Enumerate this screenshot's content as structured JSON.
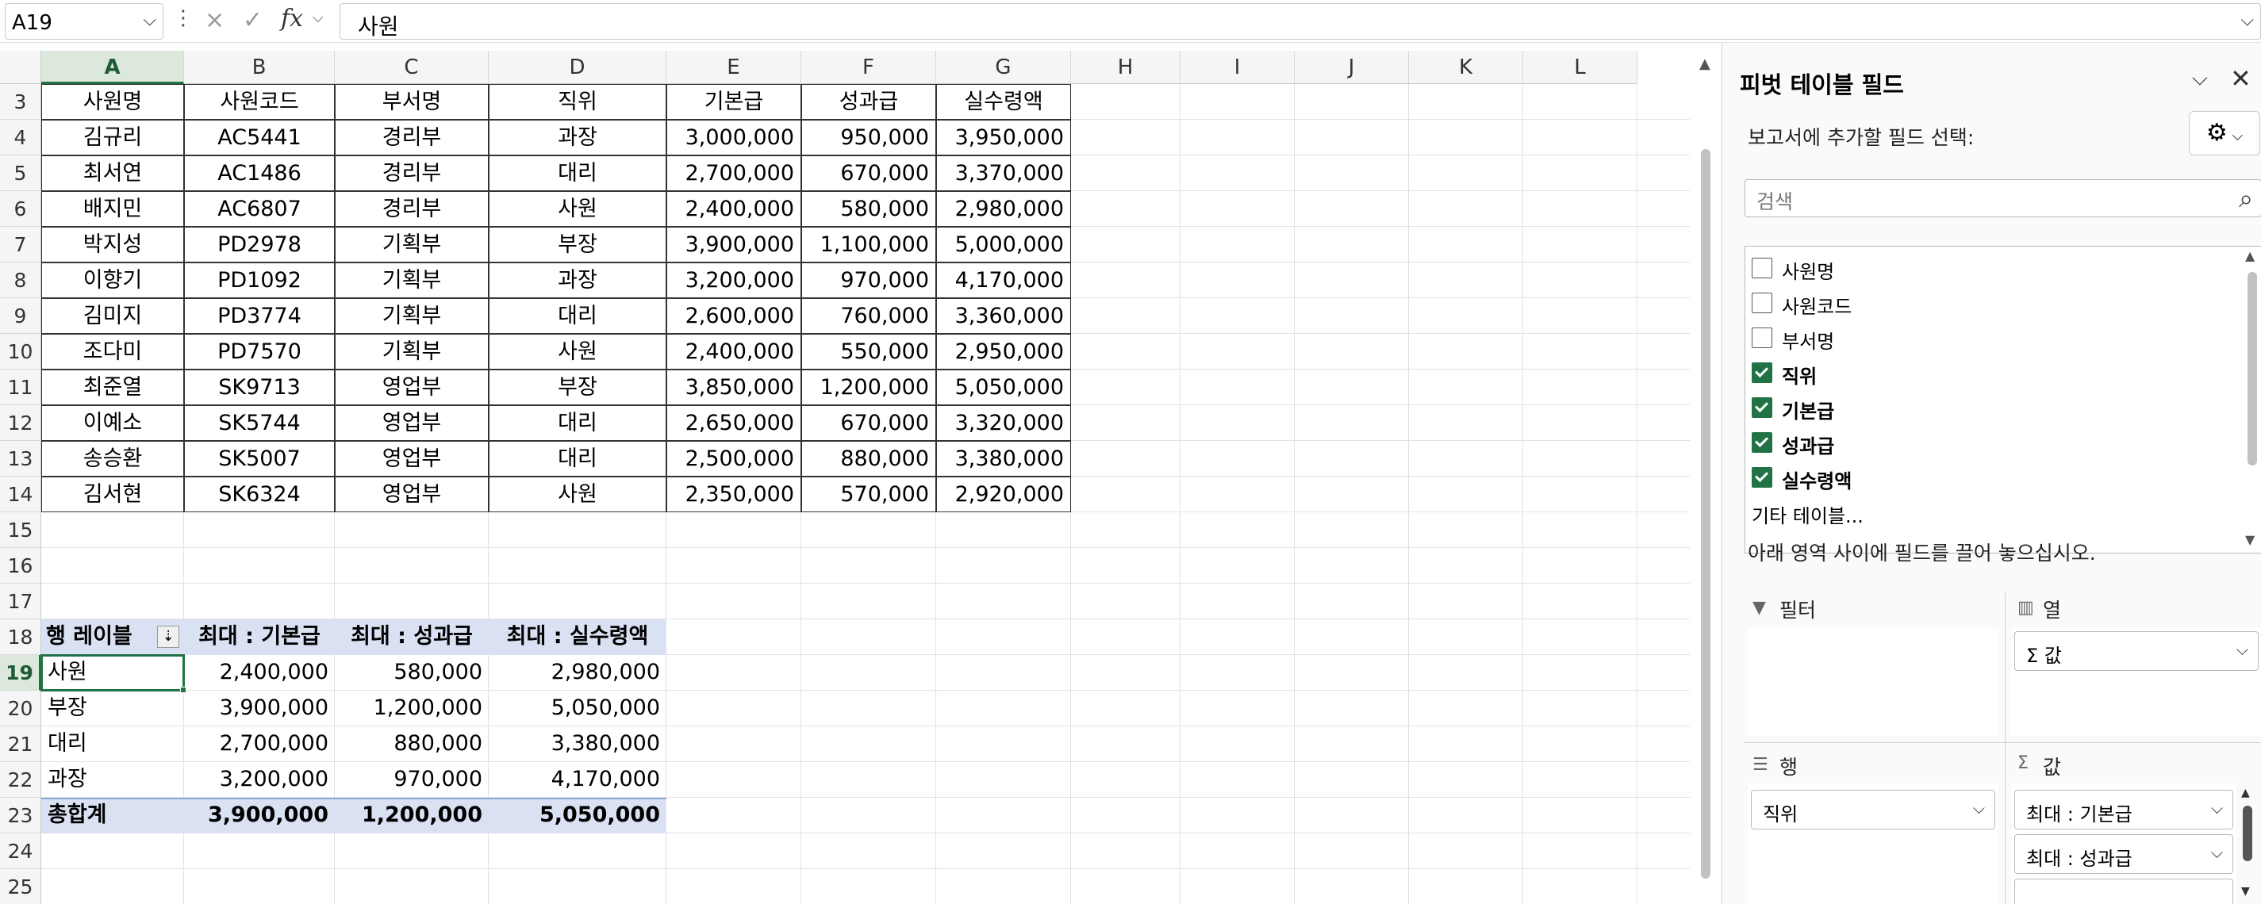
{
  "formula_bar": {
    "name_box": "A19",
    "cancel_icon": "×",
    "enter_icon": "✓",
    "fx_label": "fx",
    "formula": "사원"
  },
  "columns": [
    "A",
    "B",
    "C",
    "D",
    "E",
    "F",
    "G",
    "H",
    "I",
    "J",
    "K",
    "L"
  ],
  "rows": [
    "3",
    "4",
    "5",
    "6",
    "7",
    "8",
    "9",
    "10",
    "11",
    "12",
    "13",
    "14",
    "15",
    "16",
    "17",
    "18",
    "19",
    "20",
    "21",
    "22",
    "23",
    "24",
    "25"
  ],
  "data_table": {
    "headers": [
      "사원명",
      "사원코드",
      "부서명",
      "직위",
      "기본급",
      "성과급",
      "실수령액"
    ],
    "rows": [
      [
        "김규리",
        "AC5441",
        "경리부",
        "과장",
        "3,000,000",
        "950,000",
        "3,950,000"
      ],
      [
        "최서연",
        "AC1486",
        "경리부",
        "대리",
        "2,700,000",
        "670,000",
        "3,370,000"
      ],
      [
        "배지민",
        "AC6807",
        "경리부",
        "사원",
        "2,400,000",
        "580,000",
        "2,980,000"
      ],
      [
        "박지성",
        "PD2978",
        "기획부",
        "부장",
        "3,900,000",
        "1,100,000",
        "5,000,000"
      ],
      [
        "이향기",
        "PD1092",
        "기획부",
        "과장",
        "3,200,000",
        "970,000",
        "4,170,000"
      ],
      [
        "김미지",
        "PD3774",
        "기획부",
        "대리",
        "2,600,000",
        "760,000",
        "3,360,000"
      ],
      [
        "조다미",
        "PD7570",
        "기획부",
        "사원",
        "2,400,000",
        "550,000",
        "2,950,000"
      ],
      [
        "최준열",
        "SK9713",
        "영업부",
        "부장",
        "3,850,000",
        "1,200,000",
        "5,050,000"
      ],
      [
        "이예소",
        "SK5744",
        "영업부",
        "대리",
        "2,650,000",
        "670,000",
        "3,320,000"
      ],
      [
        "송승환",
        "SK5007",
        "영업부",
        "대리",
        "2,500,000",
        "880,000",
        "3,380,000"
      ],
      [
        "김서현",
        "SK6324",
        "영업부",
        "사원",
        "2,350,000",
        "570,000",
        "2,920,000"
      ]
    ]
  },
  "pivot": {
    "headers": [
      "행 레이블",
      "최대 : 기본급",
      "최대 : 성과급",
      "최대 : 실수령액"
    ],
    "rows": [
      [
        "사원",
        "2,400,000",
        "580,000",
        "2,980,000"
      ],
      [
        "부장",
        "3,900,000",
        "1,200,000",
        "5,050,000"
      ],
      [
        "대리",
        "2,700,000",
        "880,000",
        "3,380,000"
      ],
      [
        "과장",
        "3,200,000",
        "970,000",
        "4,170,000"
      ]
    ],
    "total": [
      "총합계",
      "3,900,000",
      "1,200,000",
      "5,050,000"
    ]
  },
  "pane": {
    "title": "피벗 테이블 필드",
    "choose_label": "보고서에 추가할 필드 선택:",
    "search_placeholder": "검색",
    "fields": [
      {
        "label": "사원명",
        "checked": false
      },
      {
        "label": "사원코드",
        "checked": false
      },
      {
        "label": "부서명",
        "checked": false
      },
      {
        "label": "직위",
        "checked": true
      },
      {
        "label": "기본급",
        "checked": true
      },
      {
        "label": "성과급",
        "checked": true
      },
      {
        "label": "실수령액",
        "checked": true
      },
      {
        "label": "기타 테이블...",
        "checked": false
      }
    ],
    "drag_hint": "아래 영역 사이에 필드를 끌어 놓으십시오.",
    "areas": {
      "filter": "필터",
      "columns": "열",
      "rows": "행",
      "values": "값"
    },
    "columns_item": "Σ 값",
    "rows_item": "직위",
    "values_items": [
      "최대 : 기본급",
      "최대 : 성과급"
    ]
  },
  "colors": {
    "accent": "#217346",
    "pivot_header": "#d9e1f2"
  }
}
